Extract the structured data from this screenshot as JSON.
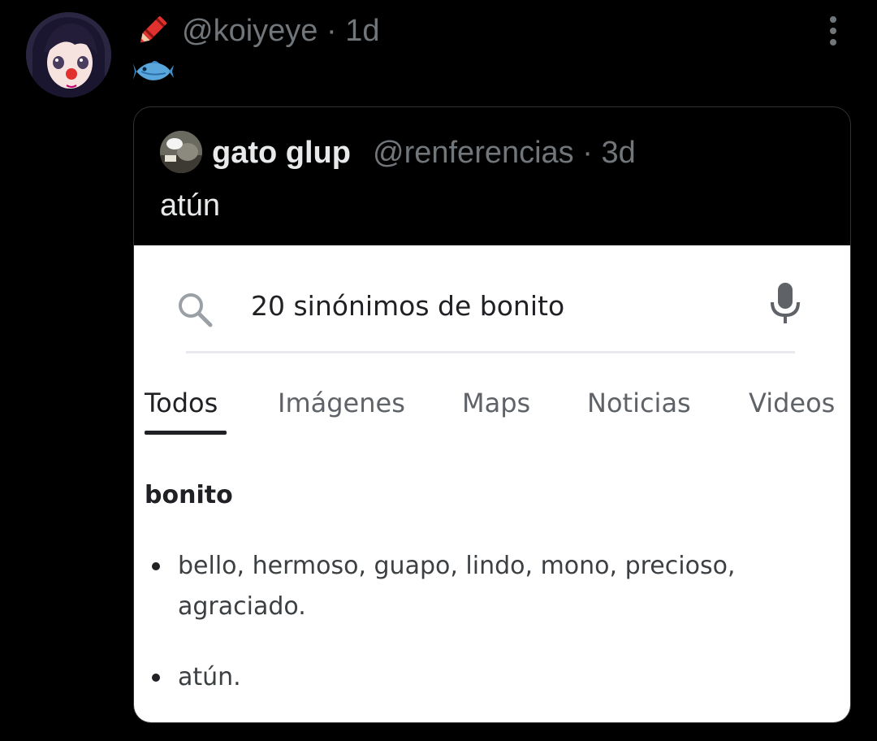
{
  "tweet": {
    "avatar_icon": "anime-girl-avatar-icon",
    "name_emoji": "crayon-icon",
    "handle": "@koiyeye",
    "separator": "·",
    "time": "1d",
    "body_emoji": "fish-icon",
    "more_icon": "vertical-ellipsis-icon"
  },
  "quoted_tweet": {
    "avatar_icon": "quoted-user-avatar-icon",
    "name": "gato glup",
    "handle": "@renferencias",
    "separator": "·",
    "time": "3d",
    "text": "atún"
  },
  "screenshot": {
    "search_query": "20 sinónimos de bonito",
    "tabs": [
      {
        "label": "Todos",
        "active": true
      },
      {
        "label": "Imágenes",
        "active": false
      },
      {
        "label": "Maps",
        "active": false
      },
      {
        "label": "Noticias",
        "active": false
      },
      {
        "label": "Videos",
        "active": false
      }
    ],
    "heading": "bonito",
    "bullets": [
      "bello, hermoso, guapo, lindo, mono, precioso, agraciado.",
      "atún."
    ]
  },
  "colors": {
    "background": "#000000",
    "text_primary": "#e7e9ea",
    "text_secondary": "#71767b",
    "border": "#2f3336"
  }
}
